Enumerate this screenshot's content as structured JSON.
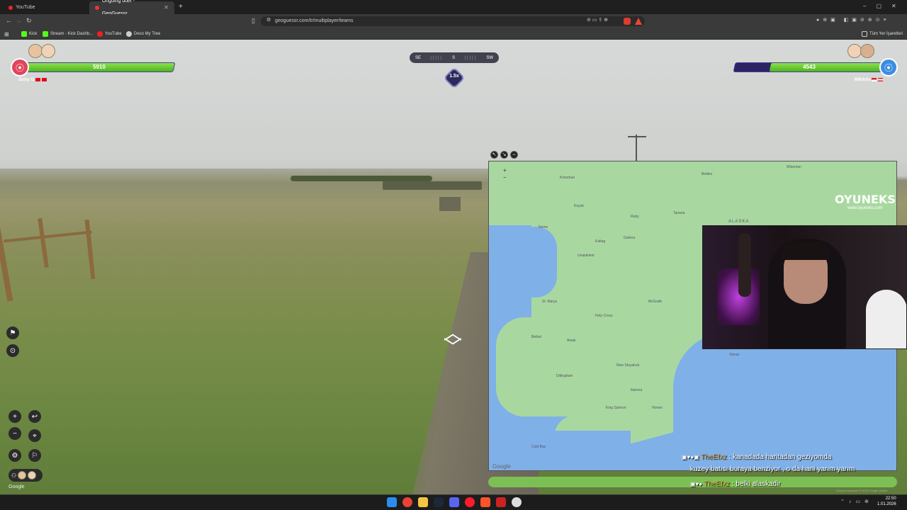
{
  "browser": {
    "tabs": [
      {
        "label": "YouTube",
        "active": false
      },
      {
        "label": "Ongoing duel - GeoGuessr",
        "active": true
      }
    ],
    "new_tab": "+",
    "url": "geoguessr.com/tr/multiplayer/teams",
    "bookmarks": [
      "Kick",
      "Stream - Kick Dashb...",
      "YouTube",
      "Deco My Tree"
    ],
    "all_bookmarks": "Tüm Yer İşaretleri"
  },
  "game": {
    "team_left": {
      "name": "Sicky G",
      "score": "5910",
      "health_fraction": 1.0,
      "color": "#e0455c"
    },
    "team_right": {
      "name": "Mik/bös",
      "score": "4543",
      "health_fraction": 0.76,
      "color": "#3b8ee0"
    },
    "compass": [
      "SE",
      "S",
      "SW"
    ],
    "multiplier": "1.5x",
    "google_label": "Google"
  },
  "map": {
    "region_label": "ALASKA",
    "google_label": "Google",
    "labels": [
      "Nome",
      "Kotzebue",
      "Bethel",
      "Dillingham",
      "King Salmon",
      "St. Marys",
      "McGrath",
      "Holy Cross",
      "Unalakleet",
      "Galena",
      "Aniak",
      "Iliamna",
      "New Stuyahok",
      "Koyuk",
      "Kaltag",
      "Ruby",
      "Tanana",
      "Bettles",
      "Wiseman",
      "Kenai",
      "Homer",
      "Cold Bay"
    ],
    "footer": "Klavye kısayolları   © 2026 Google   Şartlar"
  },
  "overlay": {
    "brand": "OYUNEKS",
    "brand_url": "www.oyuneks.com"
  },
  "chat": [
    {
      "user": "TheEfxz",
      "text": " : kanadada haritadan geziyomda"
    },
    {
      "user": "",
      "text": "kuzey batısı buraya benziyor , o da hani yarım yarım"
    },
    {
      "user": "TheEfxz",
      "text": " : belki alaskadir"
    }
  ],
  "clock": {
    "time": "22:50",
    "date": "1.01.2026"
  }
}
